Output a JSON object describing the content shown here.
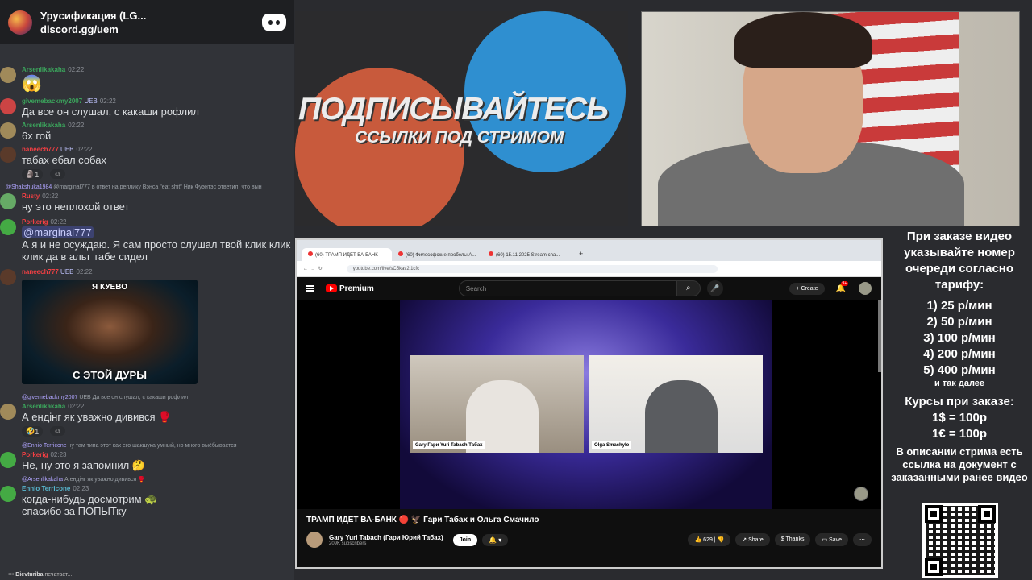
{
  "server": {
    "name": "Уруcификация (LG...",
    "invite": "discord.gg/uem"
  },
  "messages": [
    {
      "user": "Arsenlikakaha",
      "time": "02:22",
      "text": "😱",
      "color": "green"
    },
    {
      "user": "givemebackmy2007",
      "tag": "UEB",
      "time": "02:22",
      "text": "Да все он слушал, с какаши рофлил",
      "color": "green"
    },
    {
      "user": "Arsenlikakaha",
      "time": "02:22",
      "text": "6х гой",
      "color": "green"
    },
    {
      "user": "naneech777",
      "tag": "UEB",
      "time": "02:22",
      "text": "табах ебал собах",
      "color": "red",
      "reaction": "1"
    },
    {
      "reply_user": "@Shakshuka1984",
      "reply_text": "@marginal777 в ответ на реплику Вэнса \"eat shit\" Ник Фуэнтэс ответил, что вын",
      "user": "Rusty",
      "time": "02:22",
      "text": "ну это неплохой ответ",
      "color": "red"
    },
    {
      "user": "Porkerig",
      "time": "02:22",
      "mention": "@marginal777",
      "text": "А я и не осуждаю. Я сам просто слушал твой клик клик клик да в альт табе сидел",
      "color": "red"
    },
    {
      "user": "naneech777",
      "tag": "UEB",
      "time": "02:22",
      "meme_top": "Я КУЕВО",
      "meme_bottom": "С ЭТОЙ ДУРЫ",
      "color": "red"
    },
    {
      "reply_user": "@givemebackmy2007",
      "reply_text": "UEB Да все он слушал, с какаши рофлил",
      "user": "Arsenlikakaha",
      "time": "02:22",
      "text": "А ендінг як уважно дивився 🥊",
      "color": "green",
      "reaction": "1"
    },
    {
      "reply_user": "@Ennio Terricone",
      "reply_text": "ну там типа этот как его шакшука умный, но много выёбывается",
      "user": "Porkerig",
      "time": "02:23",
      "text": "Не, ну это я запомнил 🤔",
      "color": "red"
    },
    {
      "reply_user": "@Arsenlikakaha",
      "reply_text": "А ендінг як уважно дивився 🥊",
      "user": "Ennio Terricone",
      "time": "02:23",
      "text": "когда-нибудь досмотрим 🐢 спасибо за ПОПЫТку",
      "color": "teal"
    }
  ],
  "typing": {
    "user": "Dievturiba",
    "text": "печатает..."
  },
  "banner": {
    "line1": "ПОДПИСЫВАЙТЕСЬ",
    "line2": "ССЫЛКИ ПОД СТРИМОМ"
  },
  "browser": {
    "tabs": [
      "(60) ТРАМП ИДЕТ ВА-БАНК",
      "(60) Философские пробелы А...",
      "(60) 15.11.2025 Stream cha..."
    ],
    "url": "youtube.com/live/sC5kav2l1cfc",
    "search_placeholder": "Search",
    "create_label": "Create",
    "notif_badge": "9+",
    "logo_text": "Premium",
    "tile1_name": "Gary Гари Yuri Tabach Табах",
    "tile2_name": "Olga Smachylo",
    "video_title": "ТРАМП ИДЕТ ВА-БАНК 🔴 🦅 Гари Табах и Ольга Смачило",
    "channel": "Gary Yuri Tabach (Гари Юрий Табах)",
    "subscribers": "209K subscribers",
    "join": "Join",
    "likes": "629",
    "share": "Share",
    "thanks": "Thanks",
    "save": "Save"
  },
  "info": {
    "heading": "При заказе видео указывайте номер очереди согласно тарифу:",
    "tariffs": [
      "1) 25 р/мин",
      "2) 50 р/мин",
      "3) 100 р/мин",
      "4) 200 р/мин",
      "5) 400 р/мин"
    ],
    "etc": "и так далее",
    "rates_title": "Курсы при заказе:",
    "rate1": "1$ = 100р",
    "rate2": "1€ = 100р",
    "desc": "В описании стрима есть ссылка на документ с заказанными ранее видео"
  }
}
